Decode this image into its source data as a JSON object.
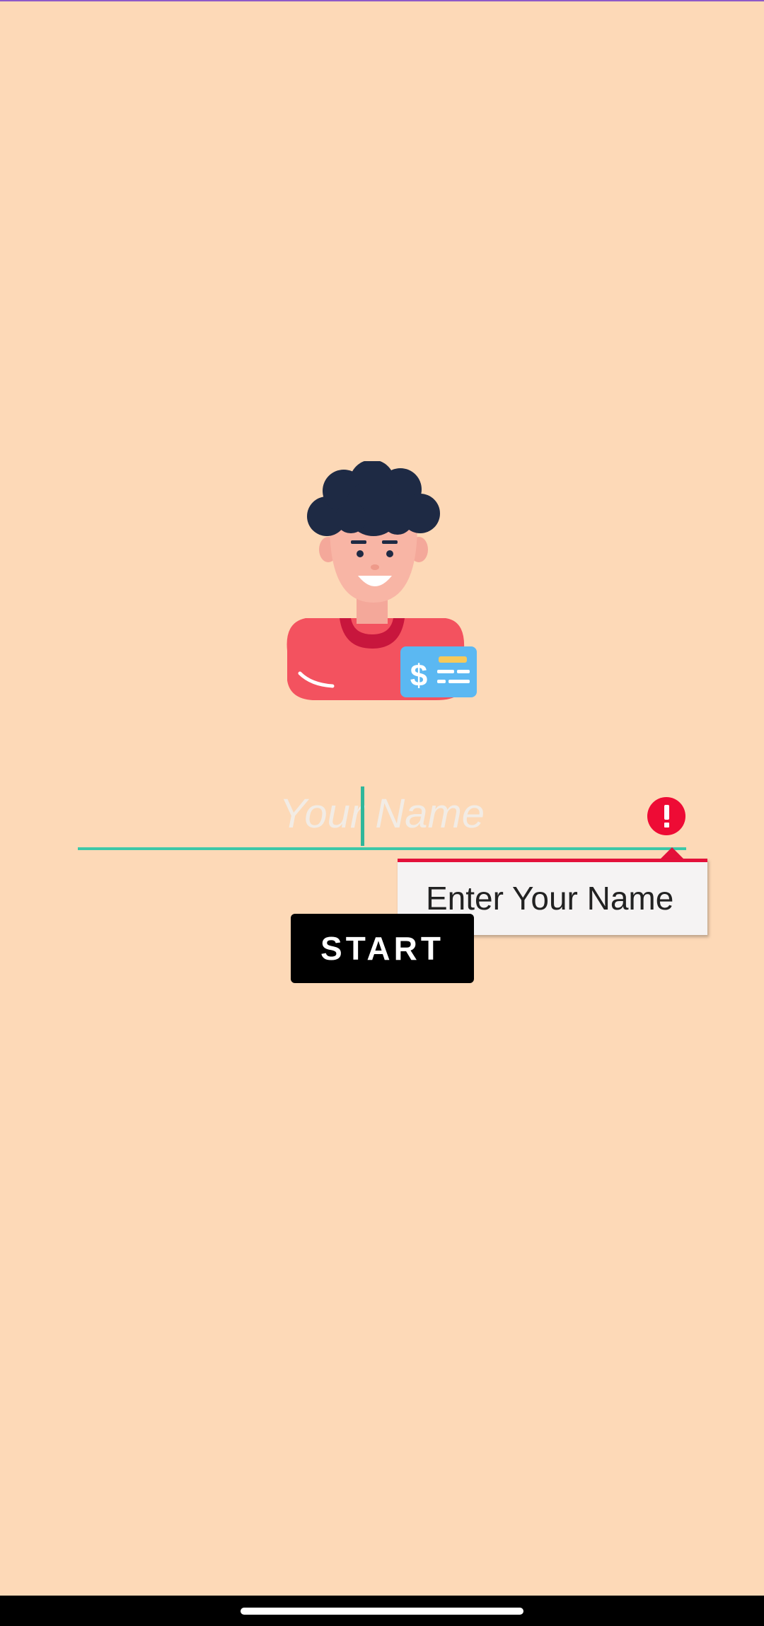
{
  "name_field": {
    "placeholder": "Your Name",
    "value": ""
  },
  "error_tooltip": {
    "message": "Enter Your Name"
  },
  "start_button": {
    "label": "START"
  },
  "icons": {
    "avatar": "person-with-dollar-card-illustration",
    "error": "exclamation-circle-icon"
  },
  "colors": {
    "background": "#FDD9B7",
    "input_underline": "#3CC8A8",
    "error": "#EE0B35",
    "button": "#000000"
  }
}
